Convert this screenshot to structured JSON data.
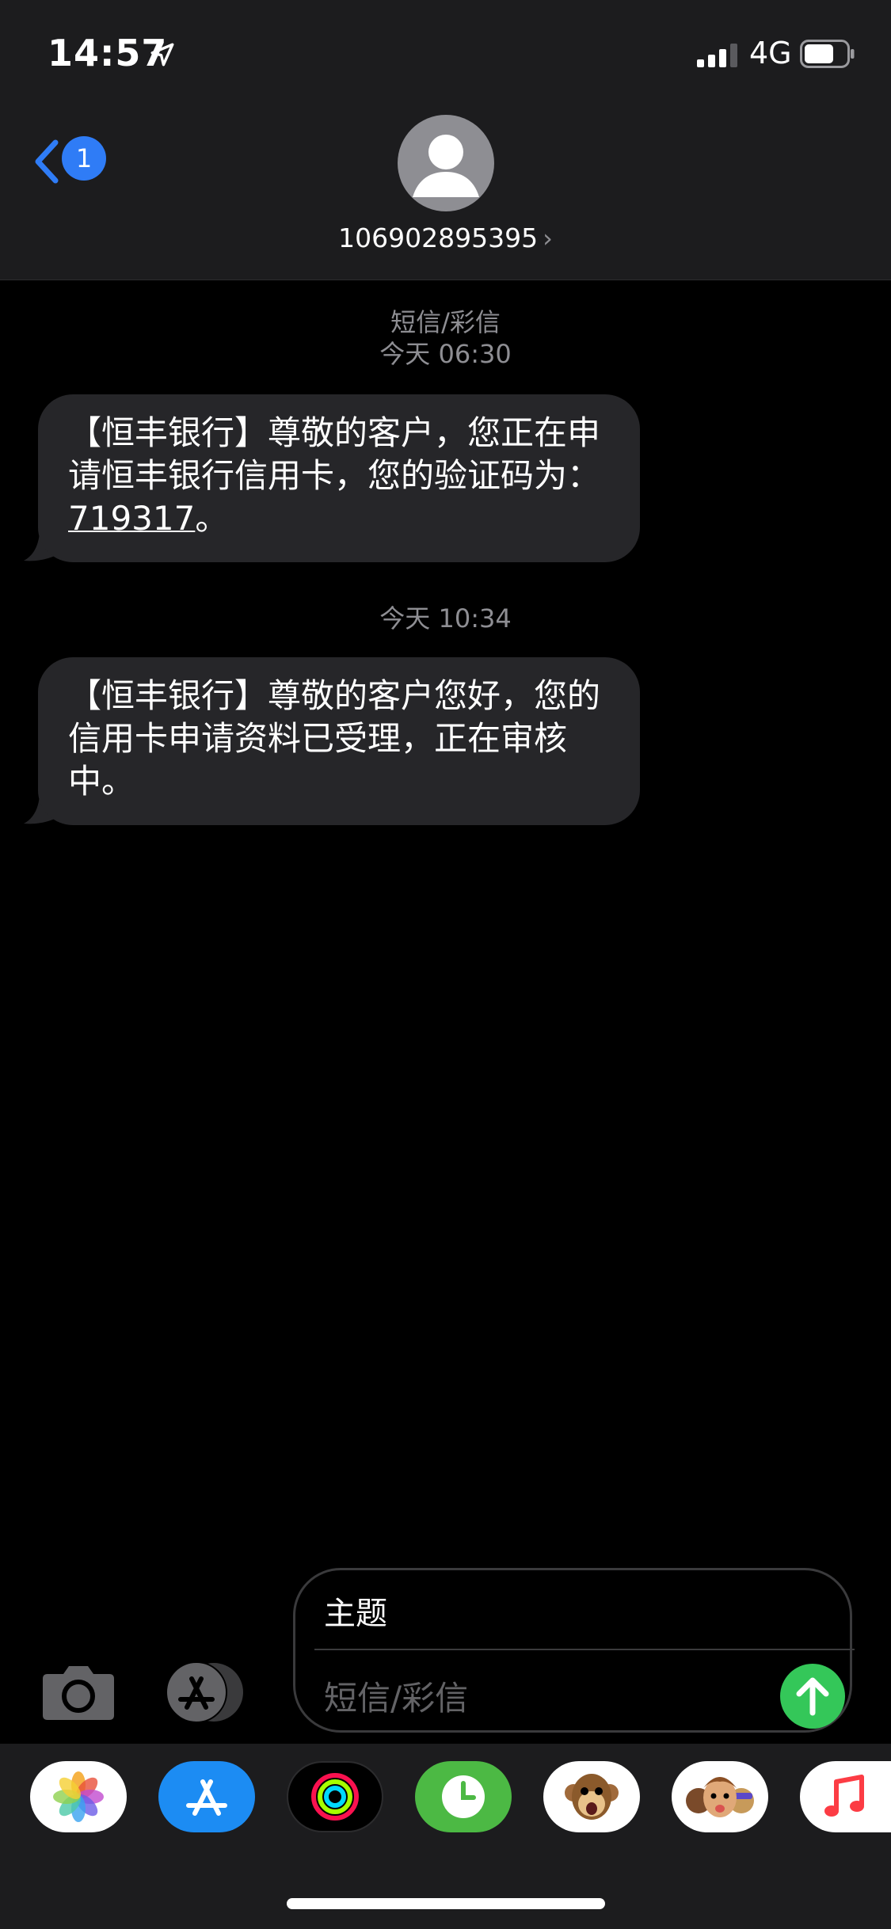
{
  "status_bar": {
    "time": "14:57",
    "network": "4G"
  },
  "header": {
    "back_badge_count": "1",
    "contact_name": "106902895395",
    "contact_chevron": "›"
  },
  "conversation": {
    "service_label": "短信/彩信",
    "messages": [
      {
        "timestamp": "今天 06:30",
        "text_before_code": "【恒丰银行】尊敬的客户，您正在申请恒丰银行信用卡，您的验证码为：",
        "code": "719317",
        "text_after_code": "。"
      },
      {
        "timestamp": "今天 10:34",
        "text": "【恒丰银行】尊敬的客户您好，您的信用卡申请资料已受理，正在审核中。"
      }
    ]
  },
  "composer": {
    "subject_placeholder": "主题",
    "message_placeholder": "短信/彩信"
  },
  "app_drawer": {
    "apps": [
      "photos-app",
      "app-store-app",
      "activity-app",
      "clock-app",
      "animoji-app",
      "memoji-app",
      "music-app"
    ]
  },
  "colors": {
    "accent_blue": "#2f7cf6",
    "send_green": "#34c759",
    "bubble_gray": "#262629",
    "meta_gray": "#8e8e93"
  }
}
